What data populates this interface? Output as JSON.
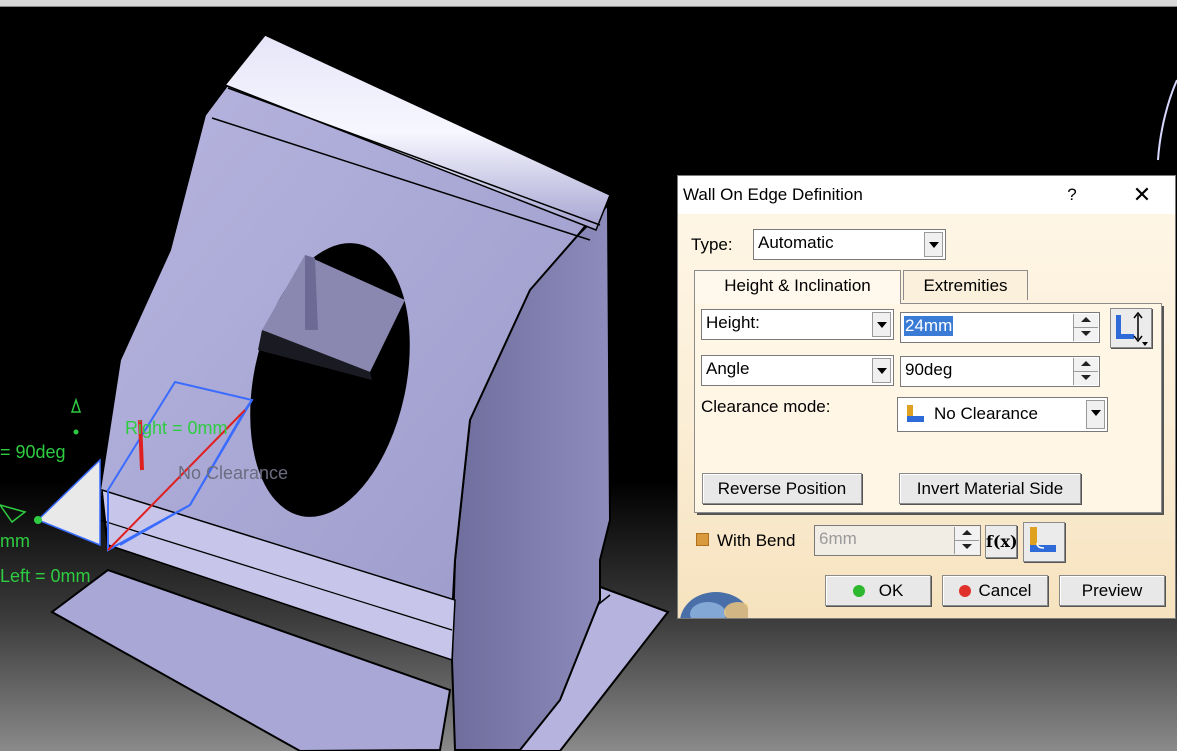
{
  "viewport": {
    "dimension_labels": {
      "angle": "= 90deg",
      "right": "Right = 0mm",
      "left": "Left = 0mm",
      "mm": "mm",
      "clearance": "No Clearance"
    }
  },
  "dialog": {
    "title": "Wall On Edge Definition",
    "help_label": "?",
    "close_label": "✕",
    "type_label": "Type:",
    "type_value": "Automatic",
    "tabs": [
      {
        "label": "Height & Inclination",
        "active": true
      },
      {
        "label": "Extremities",
        "active": false
      }
    ],
    "height_mode": "Height:",
    "height_value": "24mm",
    "angle_mode": "Angle",
    "angle_value": "90deg",
    "clearance_label": "Clearance mode:",
    "clearance_value": "No Clearance",
    "reverse_position_label": "Reverse Position",
    "invert_material_label": "Invert Material Side",
    "with_bend_label": "With Bend",
    "with_bend_checked": true,
    "bend_radius_value": "6mm",
    "formula_icon_label": "f(x)",
    "ok_label": "OK",
    "cancel_label": "Cancel",
    "preview_label": "Preview",
    "colors": {
      "ok_dot": "#2db82d",
      "cancel_dot": "#e0312b",
      "selection": "#3a7bd5"
    }
  }
}
